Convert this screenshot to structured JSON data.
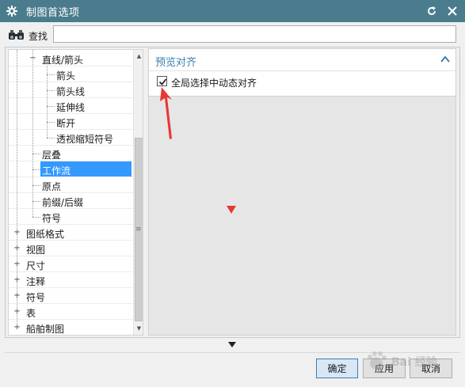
{
  "window": {
    "title": "制图首选项",
    "icon": "gear-icon",
    "reset_icon": "reset-icon",
    "close_icon": "close-icon"
  },
  "search": {
    "label": "查找",
    "value": "",
    "placeholder": ""
  },
  "tree": {
    "items": [
      {
        "label": "直线/箭头",
        "expander": "−",
        "level": 2
      },
      {
        "label": "箭头",
        "level": 3
      },
      {
        "label": "箭头线",
        "level": 3
      },
      {
        "label": "延伸线",
        "level": 3
      },
      {
        "label": "断开",
        "level": 3
      },
      {
        "label": "透视缩短符号",
        "level": 3
      },
      {
        "label": "层叠",
        "level": 2
      },
      {
        "label": "工作流",
        "level": 2,
        "selected": true
      },
      {
        "label": "原点",
        "level": 2
      },
      {
        "label": "前缀/后缀",
        "level": 2
      },
      {
        "label": "符号",
        "level": 2
      },
      {
        "label": "图纸格式",
        "expander": "+",
        "level": 1
      },
      {
        "label": "视图",
        "expander": "+",
        "level": 1
      },
      {
        "label": "尺寸",
        "expander": "+",
        "level": 1
      },
      {
        "label": "注释",
        "expander": "+",
        "level": 1
      },
      {
        "label": "符号",
        "expander": "+",
        "level": 1
      },
      {
        "label": "表",
        "expander": "+",
        "level": 1
      },
      {
        "label": "船舶制图",
        "expander": "+",
        "level": 1
      }
    ]
  },
  "panel": {
    "group_title": "预览对齐",
    "checkbox_label": "全局选择中动态对齐",
    "checkbox_checked": true
  },
  "buttons": {
    "ok": "确定",
    "apply": "应用",
    "cancel": "取消"
  },
  "watermark": {
    "text": "Bai 经验"
  },
  "colors": {
    "titlebar": "#4a7c8e",
    "accent": "#3c7fb1",
    "selection": "#3399ff",
    "annotation": "#e53935"
  }
}
